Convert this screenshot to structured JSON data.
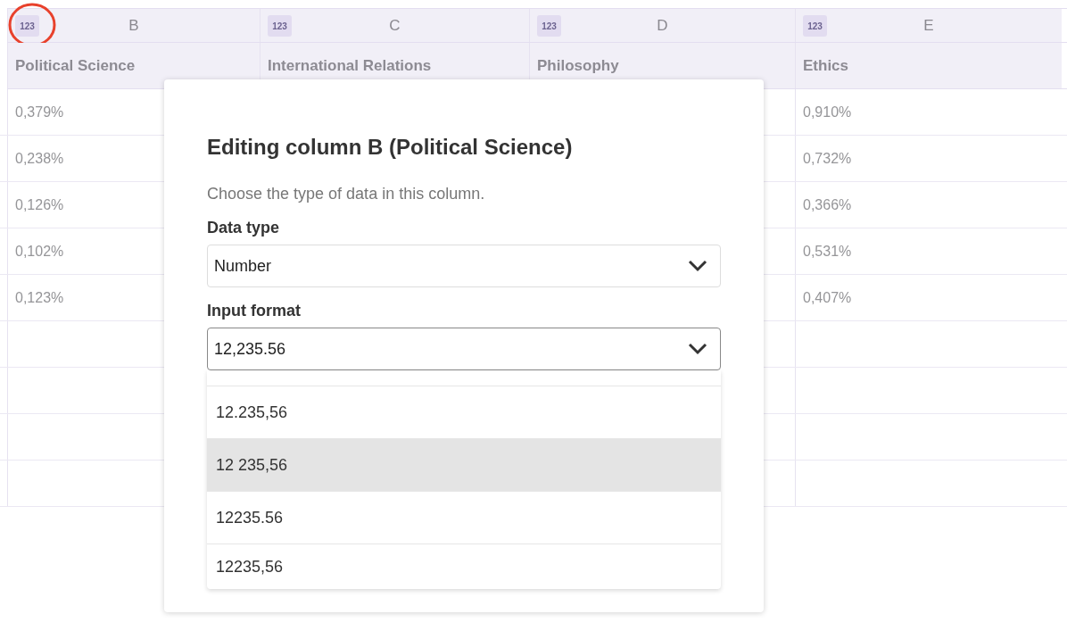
{
  "table": {
    "columns": [
      {
        "type_badge": "123",
        "letter": "B",
        "name": "Political Science",
        "highlighted": true
      },
      {
        "type_badge": "123",
        "letter": "C",
        "name": "International Relations",
        "highlighted": false
      },
      {
        "type_badge": "123",
        "letter": "D",
        "name": "Philosophy",
        "highlighted": false
      },
      {
        "type_badge": "123",
        "letter": "E",
        "name": "Ethics",
        "highlighted": false
      }
    ],
    "rows": [
      {
        "column_b": "0,379%",
        "column_e": "0,910%"
      },
      {
        "column_b": "0,238%",
        "column_e": "0,732%"
      },
      {
        "column_b": "0,126%",
        "column_e": "0,366%"
      },
      {
        "column_b": "0,102%",
        "column_e": "0,531%"
      },
      {
        "column_b": "0,123%",
        "column_e": "0,407%"
      }
    ]
  },
  "dialog": {
    "title": "Editing column B (Political Science)",
    "description": "Choose the type of data in this column.",
    "fields": [
      {
        "label": "Data type",
        "value": "Number",
        "open": false
      },
      {
        "label": "Input format",
        "value": "12,235.56",
        "open": true,
        "options": [
          {
            "label": "12.235,56",
            "highlighted": false
          },
          {
            "label": "12 235,56",
            "highlighted": true
          },
          {
            "label": "12235.56",
            "highlighted": false
          },
          {
            "label": "12235,56",
            "highlighted": false
          }
        ]
      }
    ]
  }
}
